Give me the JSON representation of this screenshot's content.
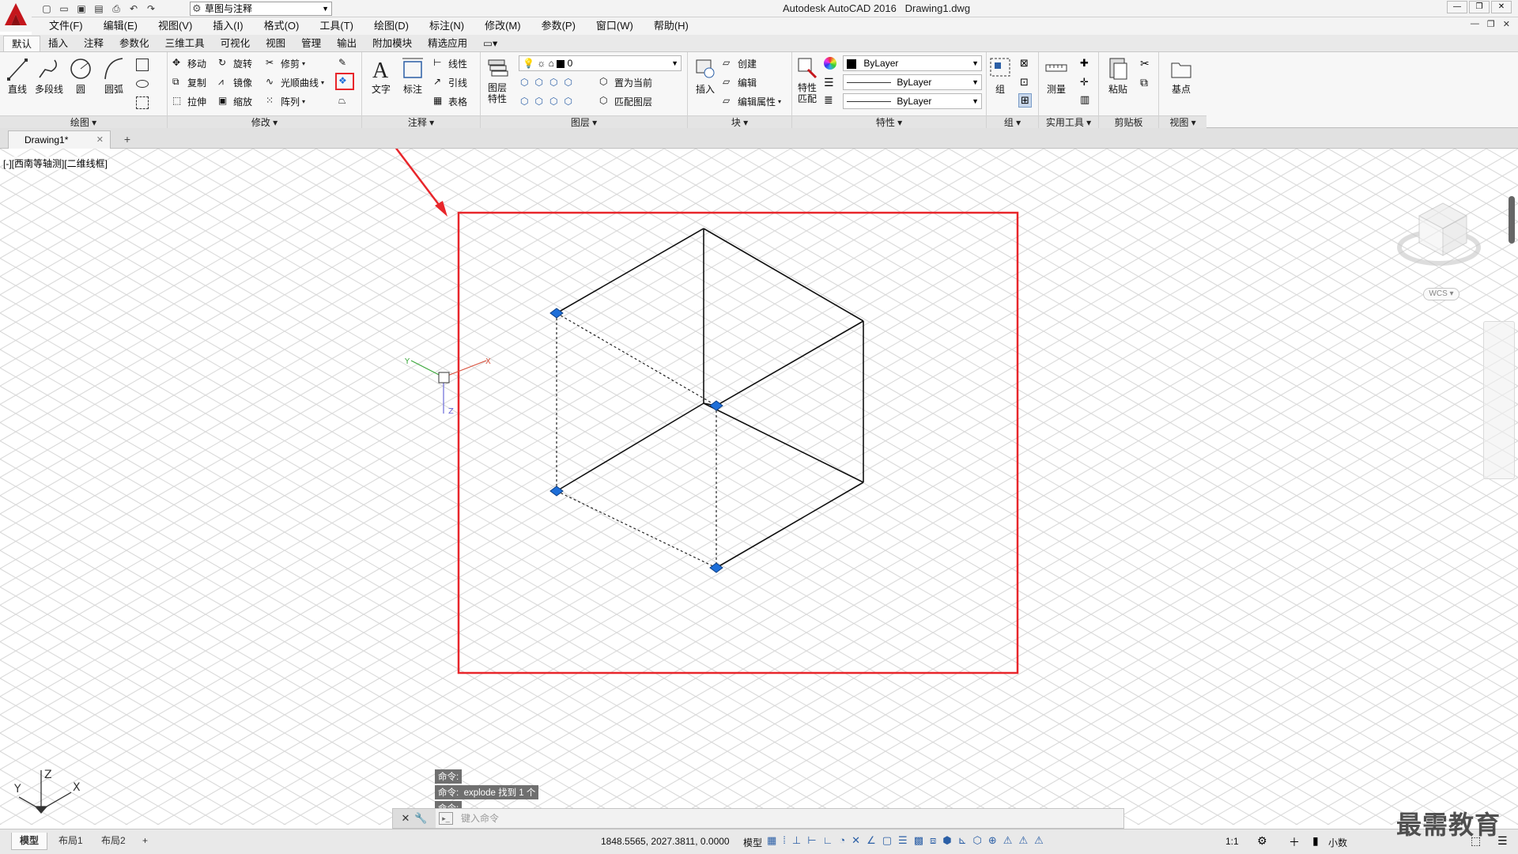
{
  "title": {
    "app": "Autodesk AutoCAD 2016",
    "file": "Drawing1.dwg"
  },
  "workspace": "草图与注释",
  "menus": [
    "文件(F)",
    "编辑(E)",
    "视图(V)",
    "插入(I)",
    "格式(O)",
    "工具(T)",
    "绘图(D)",
    "标注(N)",
    "修改(M)",
    "参数(P)",
    "窗口(W)",
    "帮助(H)"
  ],
  "ribbon_tabs": [
    "默认",
    "插入",
    "注释",
    "参数化",
    "三维工具",
    "可视化",
    "视图",
    "管理",
    "输出",
    "附加模块",
    "精选应用"
  ],
  "panels": {
    "draw": {
      "title": "绘图 ▾",
      "line": "直线",
      "polyline": "多段线",
      "circle": "圆",
      "arc": "圆弧"
    },
    "modify": {
      "title": "修改 ▾",
      "move": "移动",
      "rotate": "旋转",
      "trim": "修剪",
      "copy": "复制",
      "mirror": "镜像",
      "fillet": "光顺曲线",
      "stretch": "拉伸",
      "scale": "缩放",
      "array": "阵列"
    },
    "annotation": {
      "title": "注释 ▾",
      "text": "文字",
      "dimension": "标注",
      "linear": "线性",
      "leader": "引线",
      "table": "表格"
    },
    "layers": {
      "title": "图层 ▾",
      "layer_props": "图层特性",
      "current_layer": "0",
      "set_current": "置为当前",
      "match_layer": "匹配图层"
    },
    "block": {
      "title": "块 ▾",
      "insert": "插入",
      "create": "创建",
      "edit": "编辑",
      "edit_attr": "编辑属性"
    },
    "properties": {
      "title": "特性 ▾",
      "match": "特性匹配",
      "color": "ByLayer",
      "linetype": "ByLayer",
      "lineweight": "ByLayer"
    },
    "groups": {
      "title": "组 ▾",
      "group": "组"
    },
    "utilities": {
      "title": "实用工具 ▾",
      "measure": "测量"
    },
    "clipboard": {
      "title": "剪贴板",
      "paste": "粘贴"
    },
    "view": {
      "title": "视图 ▾",
      "base": "基点"
    }
  },
  "doc_tab": "Drawing1*",
  "viewport_label": "[-][西南等轴测][二维线框]",
  "viewcube_wcs": "WCS",
  "ucs_labels": {
    "x": "X",
    "y": "Y",
    "z": "Z"
  },
  "command_history": [
    "命令:",
    "命令:  explode 找到 1 个",
    "命令:"
  ],
  "command_placeholder": "键入命令",
  "layout_tabs": [
    "模型",
    "布局1",
    "布局2"
  ],
  "coordinates": "1848.5565, 2027.3811, 0.0000",
  "status_model": "模型",
  "status_scale": "1:1",
  "status_units": "小数",
  "watermark": "最需教育",
  "colors": {
    "highlight": "#e8262b",
    "grip": "#1e6fd9",
    "accent": "#c4161c"
  }
}
